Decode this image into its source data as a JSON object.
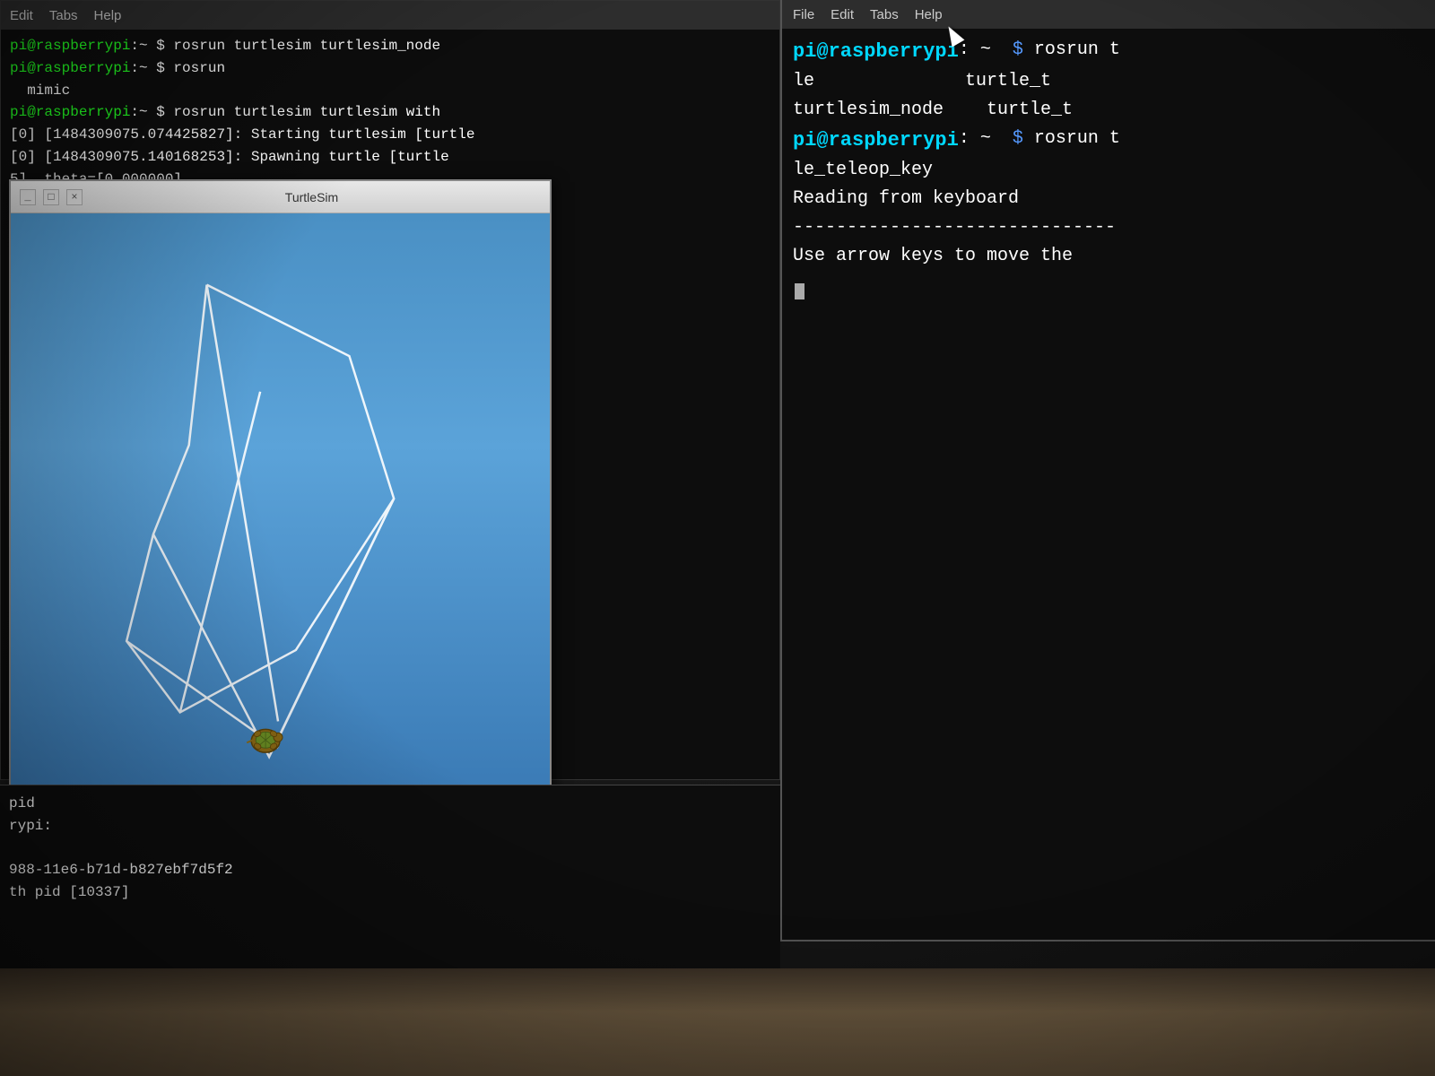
{
  "monitor": {
    "background_color": "#1a1a1a"
  },
  "terminal_left": {
    "menubar": {
      "items": [
        "Edit",
        "Tabs",
        "Help"
      ]
    },
    "lines": [
      {
        "type": "prompt",
        "user": "pi@raspberrypi",
        "text": " mimic"
      },
      {
        "type": "prompt",
        "user": "pi@raspberrypi",
        "text": " rosrun turtlesim turtlesim with"
      },
      {
        "type": "log",
        "text": "]: Starting turtlesim [turtle"
      },
      {
        "type": "log",
        "text": "]: Spawning turtle [turtle"
      },
      {
        "type": "log",
        "text": "theta=[0.000000]"
      }
    ]
  },
  "turtlesim_window": {
    "title": "TurtleSim",
    "controls": [
      "_",
      "□",
      "×"
    ]
  },
  "terminal_right": {
    "menubar": {
      "items": [
        "File",
        "Edit",
        "Tabs",
        "Help"
      ]
    },
    "header_text": "pi@raspberrypi: ~",
    "lines": [
      {
        "type": "prompt_partial",
        "user": "pi@raspberrypi",
        "cmd": "rosrun t"
      },
      {
        "type": "log",
        "text": "le"
      },
      {
        "type": "log",
        "text": "turtlesim_node        turtle_t"
      },
      {
        "type": "prompt_partial",
        "user": "pi@raspberrypi",
        "cmd": "rosrun t"
      },
      {
        "type": "log",
        "text": "le_teleop_key"
      },
      {
        "type": "log",
        "text": "Reading from keyboard"
      },
      {
        "type": "divider",
        "text": "----------------------------"
      },
      {
        "type": "log",
        "text": "Use arrow keys to move the"
      },
      {
        "type": "cursor",
        "text": "█"
      }
    ]
  },
  "terminal_bottom": {
    "lines": [
      {
        "text": "pid"
      },
      {
        "text": "rypi:"
      },
      {
        "text": ""
      },
      {
        "text": "988-11e6-b71d-b827ebf7d5f2"
      },
      {
        "text": "th pid [10337]"
      }
    ]
  }
}
